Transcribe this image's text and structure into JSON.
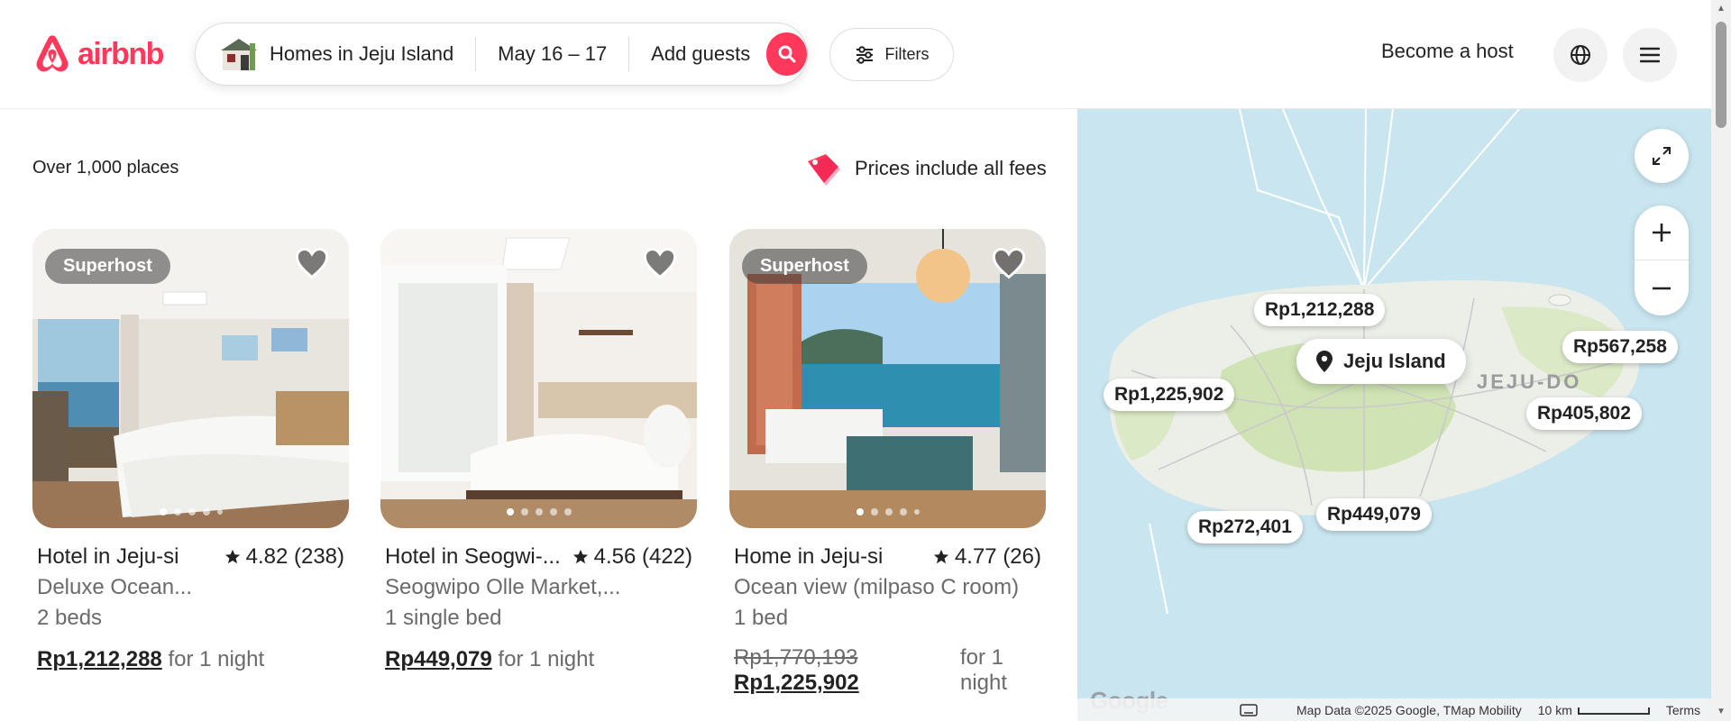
{
  "header": {
    "brand": "airbnb",
    "search": {
      "where": "Homes in Jeju Island",
      "dates": "May 16 – 17",
      "guests": "Add guests"
    },
    "filters_label": "Filters",
    "host_label": "Become a host",
    "brand_color": "#ff385c"
  },
  "results": {
    "count": "Over 1,000 places",
    "fees_note": "Prices include all fees"
  },
  "listings": [
    {
      "badge": "Superhost",
      "title": "Hotel in Jeju-si",
      "rating": "4.82 (238)",
      "subtitle": "Deluxe Ocean...",
      "beds": "2 beds",
      "price": "Rp1,212,288",
      "price_suffix": "for 1 night"
    },
    {
      "badge": "",
      "title": "Hotel in Seogwi-...",
      "rating": "4.56 (422)",
      "subtitle": "Seogwipo Olle Market,...",
      "beds": "1 single bed",
      "price": "Rp449,079",
      "price_suffix": "for 1 night"
    },
    {
      "badge": "Superhost",
      "title": "Home in Jeju-si",
      "rating": "4.77 (26)",
      "subtitle": "Ocean view (milpaso C room)",
      "beds": "1 bed",
      "original_price": "Rp1,770,193",
      "price": "Rp1,225,902",
      "price_suffix": "for 1 night"
    }
  ],
  "map": {
    "location_label": "Jeju Island",
    "region_label": "JEJU-DO",
    "price_pins": [
      "Rp1,212,288",
      "Rp1,225,902",
      "Rp567,258",
      "Rp405,802",
      "Rp272,401",
      "Rp449,079"
    ],
    "google_label": "Google",
    "attribution": "Map Data ©2025 Google, TMap Mobility",
    "scale": "10 km",
    "terms": "Terms"
  }
}
